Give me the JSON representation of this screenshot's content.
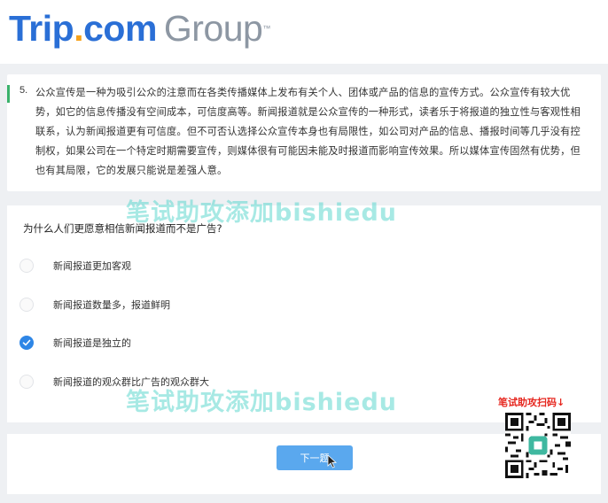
{
  "header": {
    "logo_trip": "Trip",
    "logo_dot": ".",
    "logo_com": "com",
    "logo_group": "Group",
    "logo_tm": "™"
  },
  "passage": {
    "number": "5.",
    "text": "公众宣传是一种为吸引公众的注意而在各类传播媒体上发布有关个人、团体或产品的信息的宣传方式。公众宣传有较大优势，如它的信息传播没有空间成本，可信度高等。新闻报道就是公众宣传的一种形式，读者乐于将报道的独立性与客观性相联系，认为新闻报道更有可信度。但不可否认选择公众宣传本身也有局限性，如公司对产品的信息、播报时间等几乎没有控制权，如果公司在一个特定时期需要宣传，则媒体很有可能因未能及时报道而影响宣传效果。所以媒体宣传固然有优势，但也有其局限，它的发展只能说是差强人意。"
  },
  "question": {
    "text": "为什么人们更愿意相信新闻报道而不是广告?",
    "options": [
      {
        "label": "新闻报道更加客观",
        "selected": false
      },
      {
        "label": "新闻报道数量多，报道鲜明",
        "selected": false
      },
      {
        "label": "新闻报道是独立的",
        "selected": true
      },
      {
        "label": "新闻报道的观众群比广告的观众群大",
        "selected": false
      }
    ]
  },
  "footer": {
    "next_label": "下一题"
  },
  "overlay": {
    "watermark_text": "笔试助攻添加bishiedu",
    "qr_caption": "笔试助攻扫码↓"
  },
  "colors": {
    "brand_blue": "#2a6fd6",
    "brand_orange": "#f7a21b",
    "accent_green": "#3ab26b",
    "selected_blue": "#2e86e6",
    "button_blue": "#5aa8ee",
    "caption_red": "#e6261e"
  }
}
